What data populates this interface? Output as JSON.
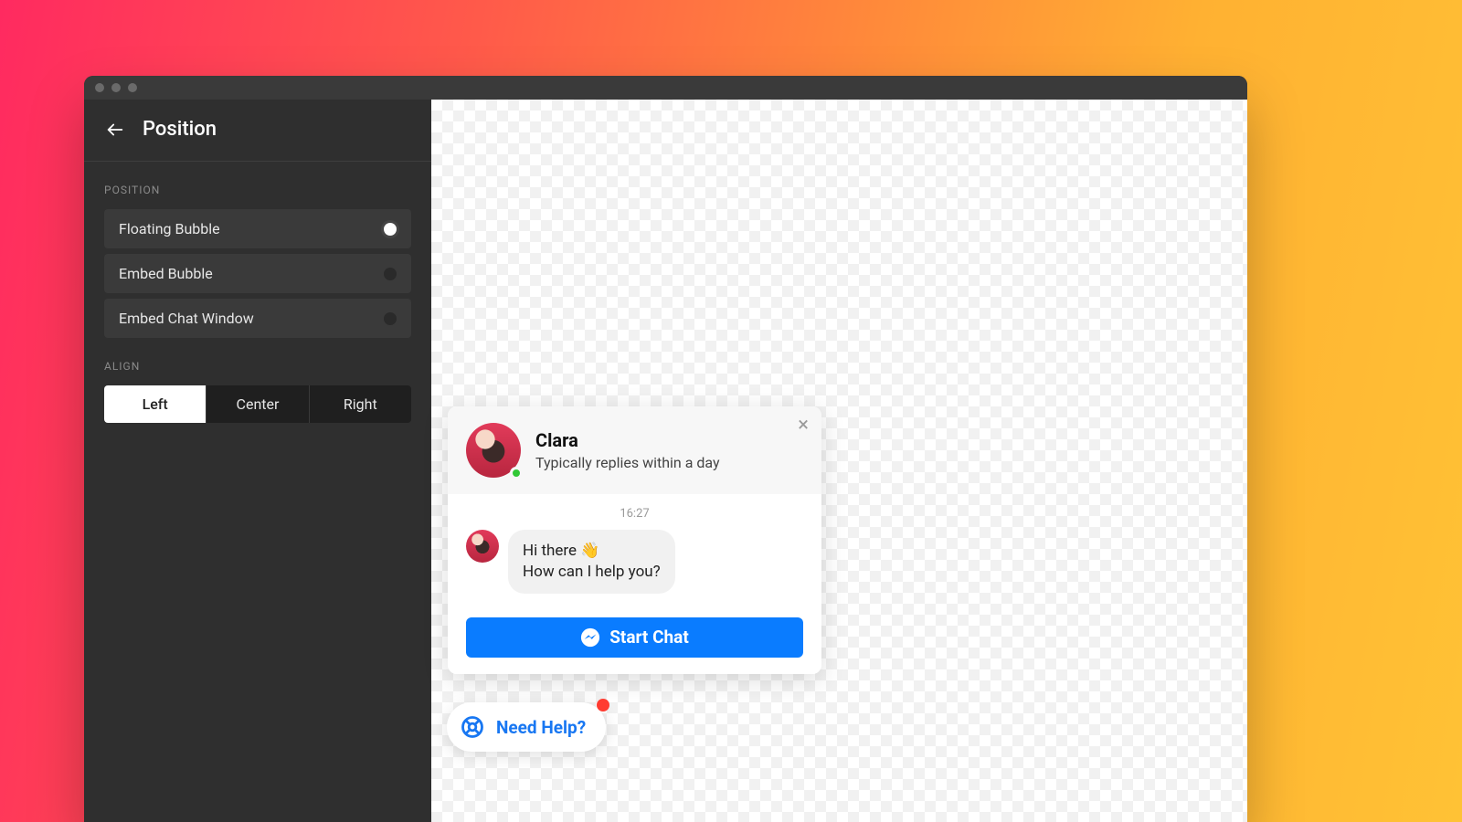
{
  "header": {
    "title": "Position"
  },
  "sidebar": {
    "position_label": "POSITION",
    "options": [
      {
        "label": "Floating Bubble",
        "selected": true
      },
      {
        "label": "Embed Bubble",
        "selected": false
      },
      {
        "label": "Embed Chat Window",
        "selected": false
      }
    ],
    "align_label": "ALIGN",
    "align": {
      "options": [
        "Left",
        "Center",
        "Right"
      ],
      "selected": "Left"
    }
  },
  "chat": {
    "name": "Clara",
    "subtitle": "Typically replies within a day",
    "timestamp": "16:27",
    "message_line1": "Hi there 👋",
    "message_line2": "How can I help you?",
    "start_button": "Start Chat"
  },
  "help_pill": {
    "label": "Need Help?",
    "has_notification": true
  },
  "colors": {
    "accent_blue": "#0a7cff",
    "link_blue": "#1877f2",
    "notify_red": "#ff3b30",
    "presence_green": "#31c836"
  }
}
